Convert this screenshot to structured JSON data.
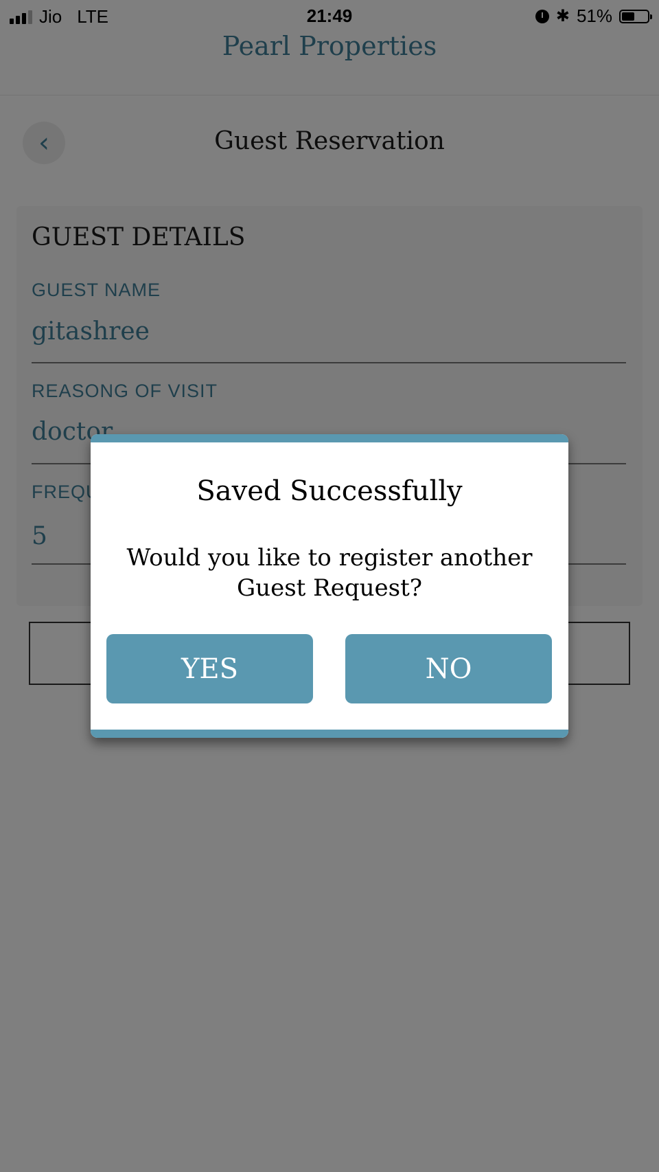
{
  "status_bar": {
    "carrier": "Jio",
    "network": "LTE",
    "time": "21:49",
    "battery_percent": "51%",
    "battery_level": 0.51,
    "icons": [
      "signal-icon",
      "alarm-icon",
      "bluetooth-icon",
      "battery-icon"
    ]
  },
  "app": {
    "title": "Pearl Properties",
    "accent_color": "#3f7f98"
  },
  "header": {
    "title": "Guest Reservation",
    "back_icon": "chevron-left-icon"
  },
  "form": {
    "section_title": "GUEST DETAILS",
    "fields": [
      {
        "label": "GUEST NAME",
        "value": "gitashree"
      },
      {
        "label": "REASONG OF VISIT",
        "value": "doctor"
      },
      {
        "label": "FREQU",
        "value": "5"
      }
    ]
  },
  "dialog": {
    "title": "Saved Successfully",
    "message": "Would you like to register another Guest Request?",
    "yes_label": "YES",
    "no_label": "NO",
    "button_color": "#5a98b0"
  }
}
